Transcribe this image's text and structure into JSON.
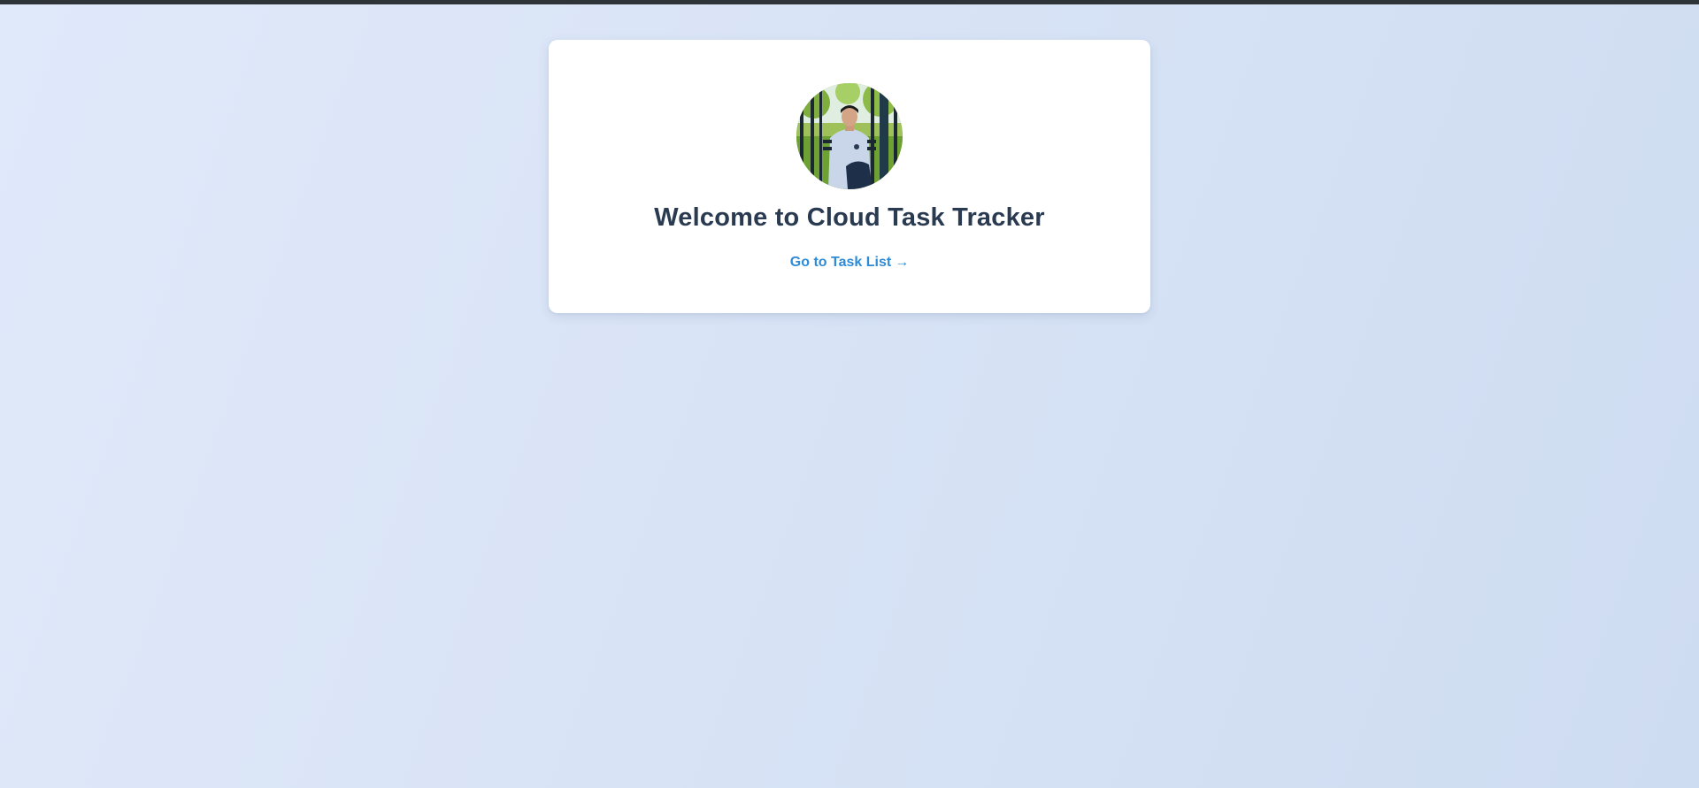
{
  "page": {
    "title": "Welcome to Cloud Task Tracker",
    "link_label": "Go to Task List",
    "link_arrow": "→"
  },
  "avatar": {
    "icon": "profile-photo"
  },
  "colors": {
    "title": "#2a3a50",
    "link": "#2f8bd6",
    "card": "#ffffff",
    "top_bar": "#2f3439"
  }
}
